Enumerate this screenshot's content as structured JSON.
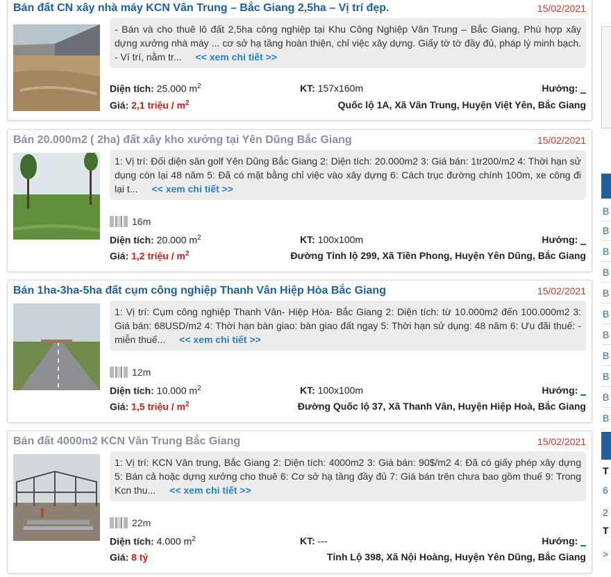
{
  "listings": [
    {
      "title": "Bán đất CN xây nhà máy KCN Vân Trung – Bắc Giang 2,5ha – Vị trí đẹp.",
      "title_color": "#1d5fa3",
      "date": "15/02/2021",
      "description": "- Bán và cho thuê lô đất 2,5ha công nghiệp tại Khu Công Nghiệp Vân Trung – Bắc Giang, Phù hợp xây dựng xưởng nhà máy ... cơ sở hạ tầng hoàn thiện, chỉ việc xây dựng. Giấy tờ tờ đầy đủ, pháp lý minh bạch. - Ví trí, nằm tr...",
      "more_label": "<< xem chi tiết >>",
      "street_width": "",
      "area_label": "Diện tích:",
      "area_value": "25.000 m",
      "area_unit_sup": "2",
      "kt_label": "KT:",
      "kt_value": "157x160m",
      "direction_label": "Hướng:",
      "direction_value": "_",
      "price_label": "Giá:",
      "price_value": "2,1 triệu / m",
      "price_sup": "2",
      "address": "Quốc lộ 1A, Xã Vân Trung, Huyện Việt Yên, Bắc Giang",
      "thumb_icon": "factory-site-photo"
    },
    {
      "title": "Bán 20.000m2 ( 2ha) đất xây kho xưởng tại Yên Dũng Bắc Giang",
      "title_color": "#8a8da8",
      "date": "15/02/2021",
      "description": "1: Vị trí: Đối diện sân golf Yên Dũng Bắc Giang 2: Diện tích: 20.000m2 3: Giá bán: 1tr200/m2 4: Thời hạn sử dụng còn lại 48 năm 5: Đã có mặt bằng chỉ việc vào xây dựng 6: Cách trục đường chính 100m, xe công đi lại t...",
      "more_label": "<< xem chi tiết >>",
      "street_width": "16m",
      "area_label": "Diện tích:",
      "area_value": "20.000 m",
      "area_unit_sup": "2",
      "kt_label": "KT:",
      "kt_value": "100x100m",
      "direction_label": "Hướng:",
      "direction_value": "_",
      "price_label": "Giá:",
      "price_value": "1,2 triệu / m",
      "price_sup": "2",
      "address": "Đường Tỉnh lộ 299, Xã Tiền Phong, Huyện Yên Dũng, Bắc Giang",
      "thumb_icon": "grass-field-photo"
    },
    {
      "title": "Bán 1ha-3ha-5ha đất cụm công nghiệp Thanh Vân Hiệp Hòa Bắc Giang",
      "title_color": "#1d5fa3",
      "date": "15/02/2021",
      "description": "1: Vị trí: Cụm công nghiệp Thanh Vân- Hiệp Hòa- Bắc Giang 2: Diện tích: từ 10.000m2 đến 100.000m2 3: Giá bán: 68USD/m2 4: Thời hạn bàn giao: bàn giao đất ngay 5: Thời hạn sử dụng: 48 năm 6: Ưu đãi thuế: - miễn thuế...",
      "more_label": "<< xem chi tiết >>",
      "street_width": "12m",
      "area_label": "Diện tích:",
      "area_value": "10.000 m",
      "area_unit_sup": "2",
      "kt_label": "KT:",
      "kt_value": "100x100m",
      "direction_label": "Hướng:",
      "direction_value": "_",
      "price_label": "Giá:",
      "price_value": "1,5 triệu / m",
      "price_sup": "2",
      "address": "Đường Quốc lộ 37, Xã Thanh Vân, Huyện Hiệp Hoà, Bắc Giang",
      "thumb_icon": "road-photo"
    },
    {
      "title": "Bán đất 4000m2 KCN Vân Trung Bắc Giang",
      "title_color": "#8a8da8",
      "date": "15/02/2021",
      "description": "1: Vị trí: KCN Vân trung, Bắc Giang 2: Diện tích: 4000m2 3: Giá bán: 90$/m2 4: Đã có giấy phép xây dựng 5: Bán cả hoặc dựng xưởng cho thuê 6: Cơ sở hạ tầng đầy đủ 7: Giá bán trên chưa bao gồm thuế 9: Trong Kcn thu...",
      "more_label": "<< xem chi tiết >>",
      "street_width": "22m",
      "area_label": "Diện tích:",
      "area_value": "4.000 m",
      "area_unit_sup": "2",
      "kt_label": "KT:",
      "kt_value": "---",
      "direction_label": "Hướng:",
      "direction_value": "_",
      "price_label": "Giá:",
      "price_value": "8 tỷ",
      "price_sup": "",
      "address": "Tỉnh Lộ 398, Xã Nội Hoàng, Huyện Yên Dũng, Bắc Giang",
      "thumb_icon": "steel-frame-photo"
    }
  ],
  "sidebar": {
    "letters": [
      "B",
      "B",
      "B",
      "B",
      "B",
      "B",
      "B",
      "B",
      "B",
      "B",
      "B"
    ],
    "bottom_items": [
      "T",
      "6",
      "2",
      "T",
      ">"
    ]
  }
}
